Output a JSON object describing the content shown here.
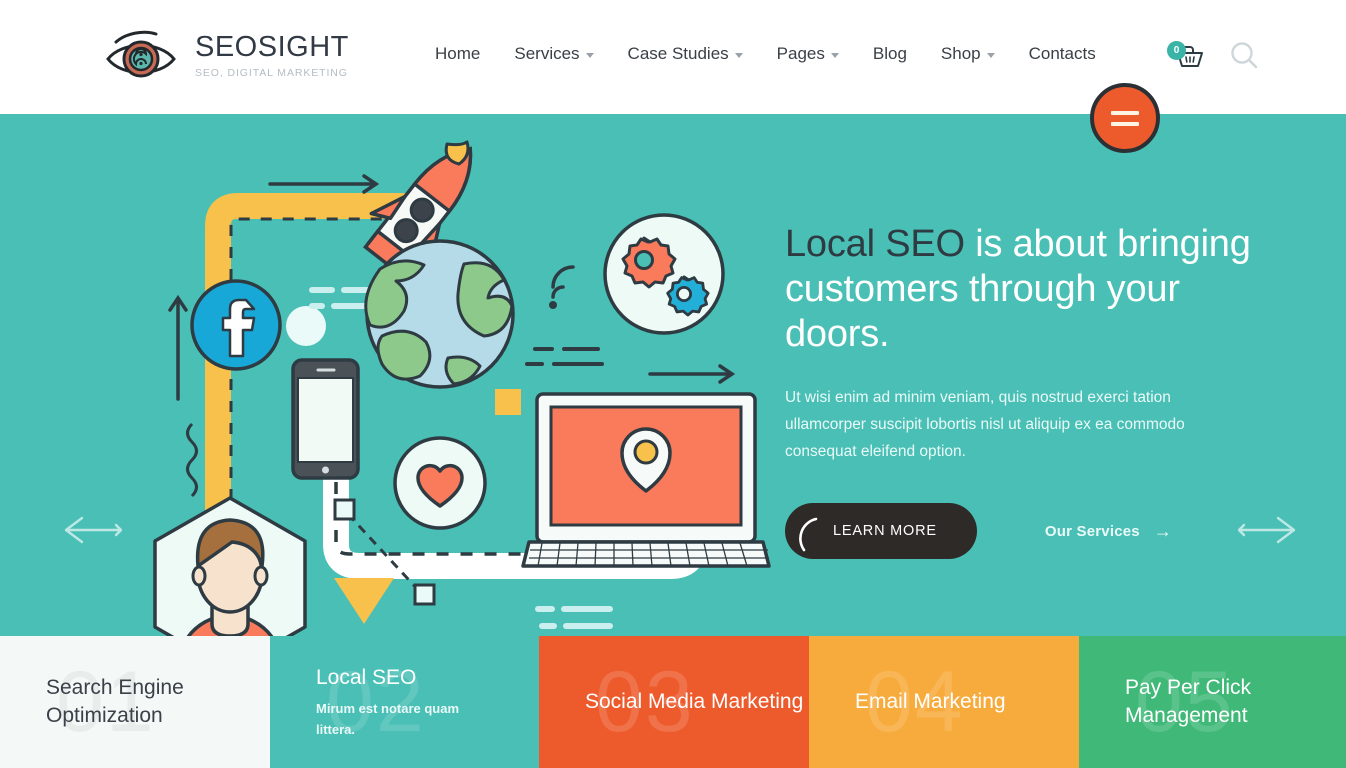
{
  "header": {
    "brand_name": "SEOSIGHT",
    "brand_tagline": "SEO, DIGITAL MARKETING",
    "logo_icon": "eye-icon",
    "nav": [
      {
        "label": "Home",
        "has_caret": false
      },
      {
        "label": "Services",
        "has_caret": true
      },
      {
        "label": "Case Studies",
        "has_caret": true
      },
      {
        "label": "Pages",
        "has_caret": true
      },
      {
        "label": "Blog",
        "has_caret": false
      },
      {
        "label": "Shop",
        "has_caret": true
      },
      {
        "label": "Contacts",
        "has_caret": false
      }
    ],
    "cart": {
      "icon": "shopping-basket-icon",
      "count": "0",
      "badge_color": "#3ab4a6"
    },
    "search": {
      "icon": "search-icon"
    },
    "menu_button": {
      "icon": "hamburger-icon",
      "color": "#ed5b2d"
    }
  },
  "hero": {
    "background_color": "#49bfb5",
    "title_accent": "Local SEO",
    "title_rest": " is about bringing customers through your doors.",
    "paragraph": "Ut wisi enim ad minim veniam, quis nostrud exerci tation ullamcorper suscipit lobortis nisl ut aliquip ex ea commodo consequat eleifend option.",
    "primary_button": "LEARN MORE",
    "secondary_link": "Our Services",
    "secondary_link_arrow": "→",
    "prev_arrow_icon": "arrow-left-icon",
    "next_arrow_icon": "arrow-right-icon",
    "illustration_icons": [
      "rocket-icon",
      "facebook-icon",
      "globe-icon",
      "smartphone-icon",
      "gears-icon",
      "wifi-signal-icon",
      "heart-icon",
      "laptop-icon",
      "map-pin-icon",
      "person-avatar-icon",
      "triangle-shape",
      "square-shape",
      "arrow-right-icon"
    ]
  },
  "cards": [
    {
      "number": "01",
      "title": "Search Engine Optimization",
      "desc": "",
      "color": "#f4f8f6",
      "theme": "light"
    },
    {
      "number": "02",
      "title": "Local SEO",
      "desc": "Mirum est notare quam littera.",
      "color": "#49bfb5",
      "theme": "dark"
    },
    {
      "number": "03",
      "title": "Social Media Marketing",
      "desc": "",
      "color": "#ed5b2d",
      "theme": "dark"
    },
    {
      "number": "04",
      "title": "Email Marketing",
      "desc": "",
      "color": "#f7ab3c",
      "theme": "dark"
    },
    {
      "number": "05",
      "title": "Pay Per Click Management",
      "desc": "",
      "color": "#3fb878",
      "theme": "dark"
    }
  ]
}
